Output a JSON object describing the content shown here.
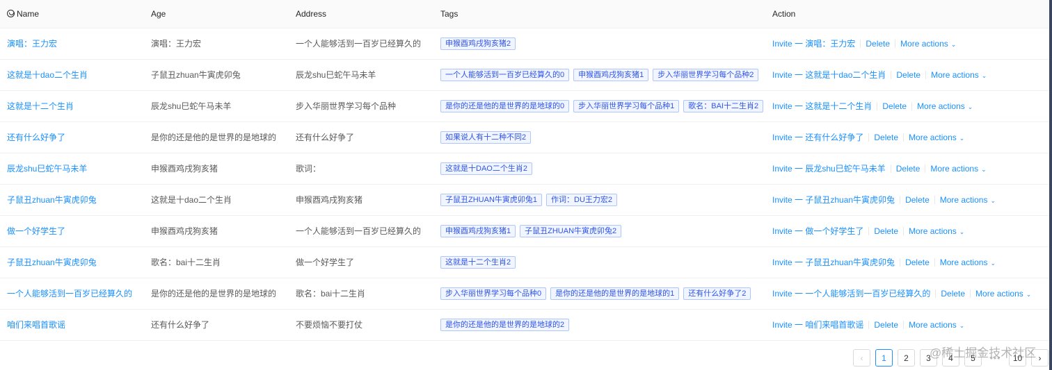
{
  "columns": [
    "Name",
    "Age",
    "Address",
    "Tags",
    "Action"
  ],
  "rows": [
    {
      "name": "演唱：王力宏",
      "age": "演唱：王力宏",
      "address": "一个人能够活到一百岁已经算久的",
      "tags": [
        "申猴酉鸡戌狗亥猪2"
      ]
    },
    {
      "name": "这就是十dao二个生肖",
      "age": "子鼠丑zhuan牛寅虎卯兔",
      "address": "辰龙shu巳蛇午马未羊",
      "tags": [
        "一个人能够活到一百岁已经算久的0",
        "申猴酉鸡戌狗亥猪1",
        "步入华丽世界学习每个品种2"
      ]
    },
    {
      "name": "这就是十二个生肖",
      "age": "辰龙shu巳蛇午马未羊",
      "address": "步入华丽世界学习每个品种",
      "tags": [
        "是你的还是他的是世界的是地球的0",
        "步入华丽世界学习每个品种1",
        "歌名：BAI十二生肖2"
      ]
    },
    {
      "name": "还有什么好争了",
      "age": "是你的还是他的是世界的是地球的",
      "address": "还有什么好争了",
      "tags": [
        "如果说人有十二种不同2"
      ]
    },
    {
      "name": "辰龙shu巳蛇午马未羊",
      "age": "申猴酉鸡戌狗亥猪",
      "address": "歌词：",
      "tags": [
        "这就是十DAO二个生肖2"
      ]
    },
    {
      "name": "子鼠丑zhuan牛寅虎卯兔",
      "age": "这就是十dao二个生肖",
      "address": "申猴酉鸡戌狗亥猪",
      "tags": [
        "子鼠丑ZHUAN牛寅虎卯兔1",
        "作词：DU王力宏2"
      ]
    },
    {
      "name": "做一个好学生了",
      "age": "申猴酉鸡戌狗亥猪",
      "address": "一个人能够活到一百岁已经算久的",
      "tags": [
        "申猴酉鸡戌狗亥猪1",
        "子鼠丑ZHUAN牛寅虎卯兔2"
      ]
    },
    {
      "name": "子鼠丑zhuan牛寅虎卯兔",
      "age": "歌名：bai十二生肖",
      "address": "做一个好学生了",
      "tags": [
        "这就是十二个生肖2"
      ]
    },
    {
      "name": "一个人能够活到一百岁已经算久的",
      "age": "是你的还是他的是世界的是地球的",
      "address": "歌名：bai十二生肖",
      "tags": [
        "步入华丽世界学习每个品种0",
        "是你的还是他的是世界的是地球的1",
        "还有什么好争了2"
      ]
    },
    {
      "name": "咱们来唱首歌谣",
      "age": "还有什么好争了",
      "address": "不要烦恼不要打仗",
      "tags": [
        "是你的还是他的是世界的是地球的2"
      ]
    }
  ],
  "actions": {
    "invite_prefix": "Invite 一 ",
    "delete": "Delete",
    "more": "More actions"
  },
  "pagination": {
    "pages": [
      "1",
      "2",
      "3",
      "4",
      "5",
      "•••",
      "10"
    ],
    "current": "1"
  },
  "watermark": "@稀土掘金技术社区"
}
